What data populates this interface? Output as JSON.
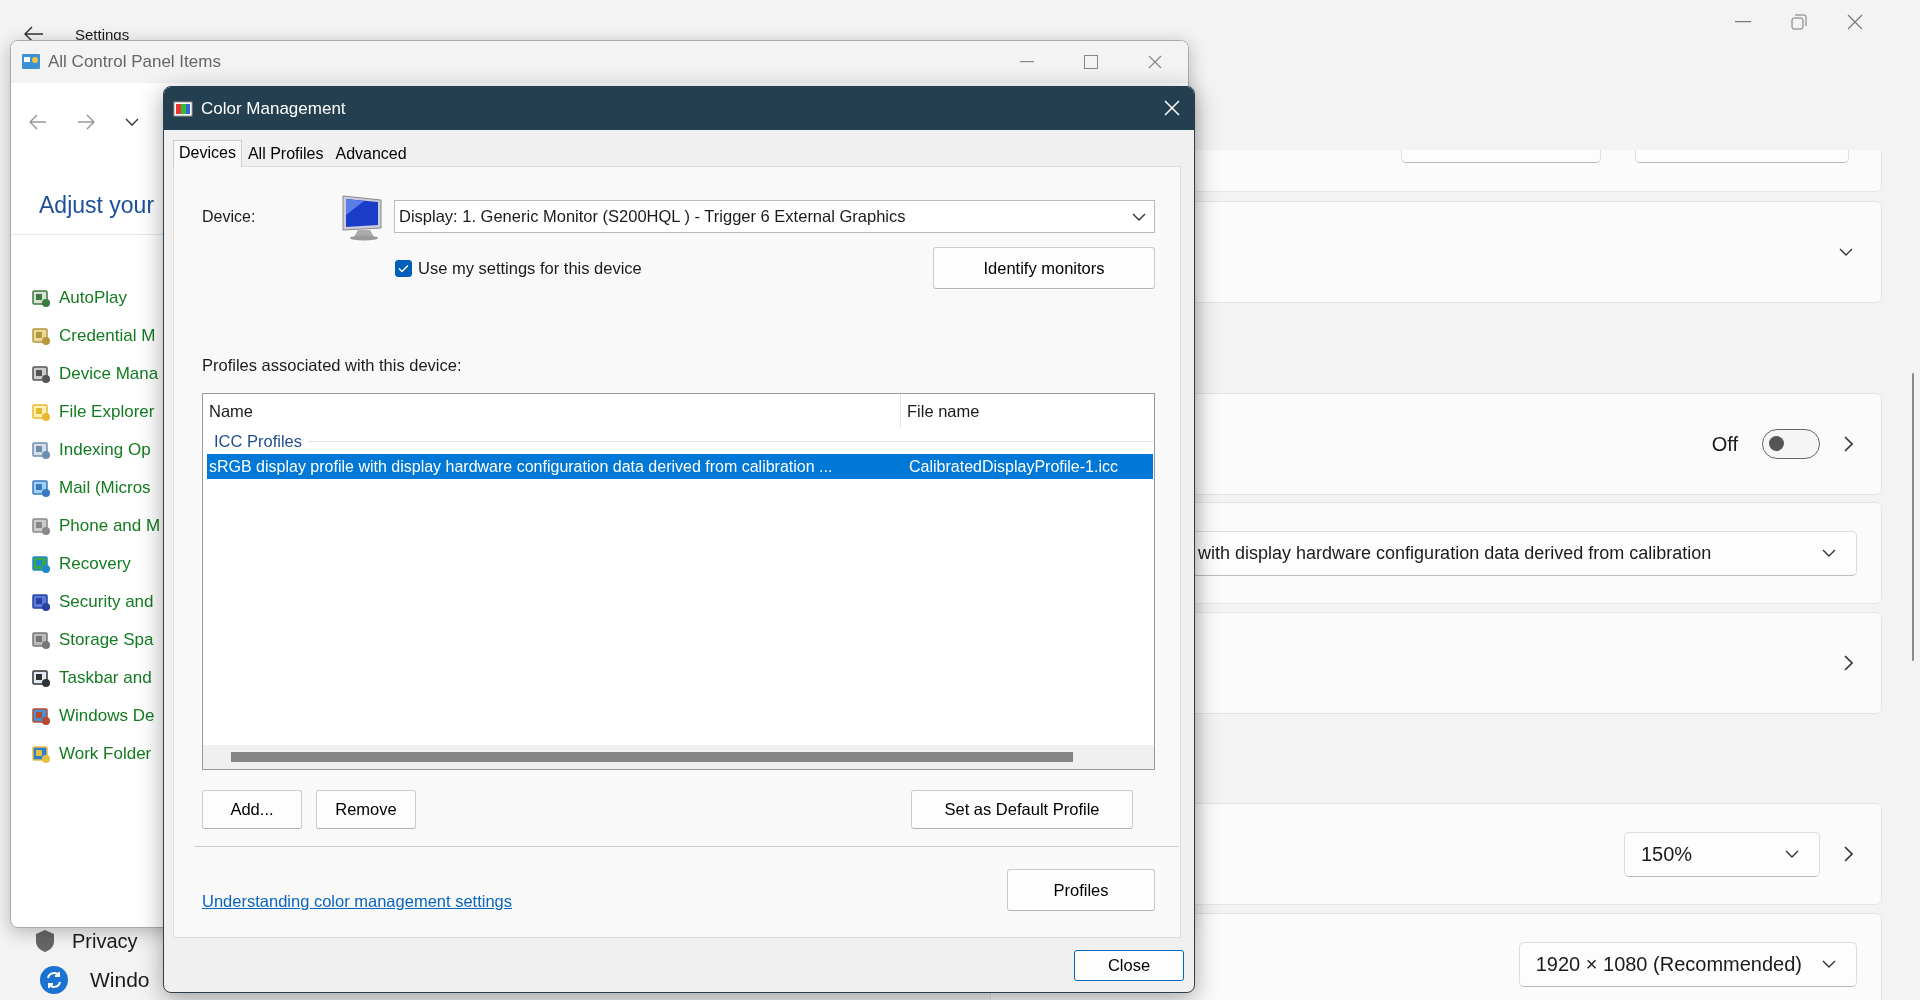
{
  "settings": {
    "title": "Settings",
    "cards": [
      {
        "kind": "buttons"
      },
      {
        "kind": "expand"
      },
      {
        "kind": "toggle",
        "label": "Off",
        "on": false
      },
      {
        "kind": "dropdown",
        "value": "with display hardware configuration data derived from calibration"
      },
      {
        "kind": "link"
      },
      {
        "kind": "dropdown_link",
        "value": "150%"
      },
      {
        "kind": "dropdown",
        "value": "1920 × 1080 (Recommended)"
      }
    ],
    "nav": [
      {
        "kind": "shield",
        "label": "Privacy"
      },
      {
        "kind": "update",
        "label": "Windo"
      }
    ]
  },
  "control_panel": {
    "title": "All Control Panel Items",
    "heading": "Adjust your",
    "items": [
      {
        "label": "AutoPlay"
      },
      {
        "label": "Credential M"
      },
      {
        "label": "Device Mana"
      },
      {
        "label": "File Explorer"
      },
      {
        "label": "Indexing Op"
      },
      {
        "label": "Mail (Micros"
      },
      {
        "label": "Phone and M"
      },
      {
        "label": "Recovery"
      },
      {
        "label": "Security and"
      },
      {
        "label": "Storage Spa"
      },
      {
        "label": "Taskbar and"
      },
      {
        "label": "Windows De"
      },
      {
        "label": "Work Folder"
      }
    ]
  },
  "dialog": {
    "title": "Color Management",
    "tabs": [
      {
        "label": "Devices",
        "selected": true
      },
      {
        "label": "All Profiles",
        "selected": false
      },
      {
        "label": "Advanced",
        "selected": false
      }
    ],
    "device_label": "Device:",
    "device": "Display: 1. Generic Monitor (S200HQL ) - Trigger 6 External Graphics",
    "use_settings": {
      "label": "Use my settings for this device",
      "checked": true
    },
    "identify_button": "Identify monitors",
    "profiles_label": "Profiles associated with this device:",
    "columns": [
      "Name",
      "File name"
    ],
    "group": "ICC Profiles",
    "rows": [
      {
        "name": "sRGB display profile with display hardware configuration data derived from calibration ...",
        "file": "CalibratedDisplayProfile-1.icc",
        "selected": true
      }
    ],
    "buttons": [
      "Add...",
      "Remove"
    ],
    "default_button": "Set as Default Profile",
    "link": "Understanding color management settings",
    "profiles_button": "Profiles",
    "close_button": "Close"
  }
}
